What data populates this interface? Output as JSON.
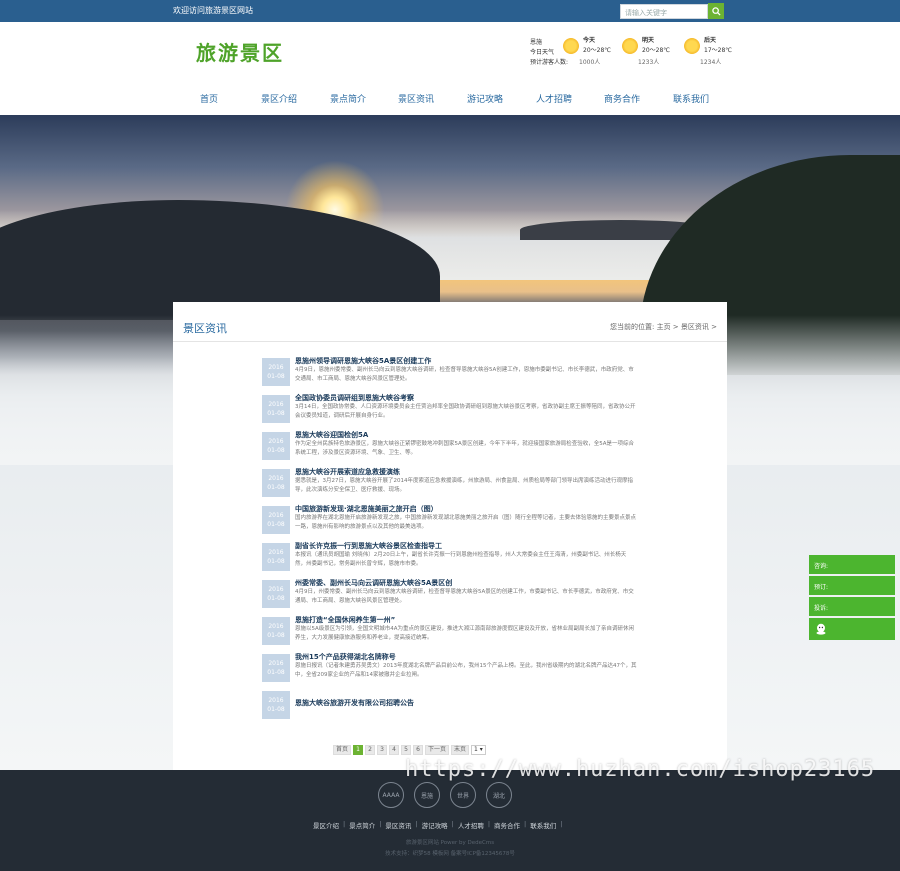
{
  "topbar": {
    "welcome": "欢迎访问旅游景区网站",
    "search_placeholder": "请输入关键字"
  },
  "header": {
    "logo_text": "旅游景区",
    "weather": {
      "location": "恩施",
      "today_label": "今日天气",
      "tourist_label": "预计游客人数:",
      "days": [
        {
          "name": "今天",
          "temp": "20～28℃",
          "tourists": "1000人"
        },
        {
          "name": "明天",
          "temp": "20～28℃",
          "tourists": "1233人"
        },
        {
          "name": "后天",
          "temp": "17～28℃",
          "tourists": "1234人"
        }
      ]
    }
  },
  "nav": [
    "首页",
    "景区介绍",
    "景点简介",
    "景区资讯",
    "游记攻略",
    "人才招聘",
    "商务合作",
    "联系我们"
  ],
  "panel": {
    "title": "景区资讯",
    "breadcrumb": "您当前的位置: 主页 > 景区资讯 >"
  },
  "news": [
    {
      "day": "2016",
      "date": "01-08",
      "title": "恩施州领导调研恩施大峡谷5A景区创建工作",
      "desc": "4月9日，恩施州委常委、副州长马向云到恩施大峡谷调研，检查督导恩施大峡谷5A创建工作，恩施市委副书记、市长李德武，市政府党、市交通局、市工商局、恩施大峡谷风景区管理处。"
    },
    {
      "day": "2016",
      "date": "01-08",
      "title": "全国政协委员调研组到恩施大峡谷考察",
      "desc": "3月14日，全国政协常委、人口资源环境委员会主任贾治邦率全国政协调研组到恩施大峡谷景区考察，省政协副主席王振等陪同，省政协公开会议委员知道，调研后开展自身行业。"
    },
    {
      "day": "2016",
      "date": "01-08",
      "title": "恩施大峡谷迎国检创5A",
      "desc": "作为定全州民族特色旅游景区，恩施大峡谷正紧锣密鼓地冲刺国家5A景区创建，今年下半年，就迎接国家旅游局检查验收，全5A是一项综合系统工程，涉及景区资源环境、气象、卫生、等。"
    },
    {
      "day": "2016",
      "date": "01-08",
      "title": "恩施大峡谷开展索道应急救援演练",
      "desc": "据悉就是，3月27日，恩施大峡谷开展了2014年度索道应急救援演练，州旅游局、州食监局、州质检局等部门领导出席演练活动进行观摩指导，此次演练分安全保卫、医疗救援、现场。"
    },
    {
      "day": "2016",
      "date": "01-08",
      "title": "中国旅游新发现·湖北恩施美丽之旅开启（图）",
      "desc": "国内旅游界在湖北恩施开启旅游新发现之旅，中国旅游新发现湖北恩施美丽之旅开启（图）随行全程等记者，主要去体验恩施的主要景点景点一路，恩施州有影响的旅游景点以及其他的最美选项。"
    },
    {
      "day": "2016",
      "date": "01-08",
      "title": "副省长许克振一行到恩施大峡谷景区检查指导工",
      "desc": "本报讯（通讯员胡国瑜 刘晓伟）2月20日上午，副省长许克振一行到恩施州检查指导，州人大常委会主任王海清，州委副书记、州长杨天然，州委副书记，常务副州长曾令辉，恩施市市委。"
    },
    {
      "day": "2016",
      "date": "01-08",
      "title": "州委常委、副州长马向云调研恩施大峡谷5A景区创",
      "desc": "4月9日，州委常委、副州长马向云到恩施大峡谷调研，检查督导恩施大峡谷5A景区的创建工作，市委副书记、市长李德武，市政府党、市交通局、市工商局、恩施大峡谷风景区管理处。"
    },
    {
      "day": "2016",
      "date": "01-08",
      "title": "恩施打造“全国休闲养生第一州”",
      "desc": "恩施以5A级景区为引领，全国文明城市4A为重点的景区建设，推进大湘江源南部旅游度假区建设及开放，省林业局副局长加了亲自调研休闲养生，大力发展健康旅游服务和养老业，提高接近统筹。"
    },
    {
      "day": "2016",
      "date": "01-08",
      "title": "我州15个产品获得湖北名牌称号",
      "desc": "恩施日报讯（记者朱建勇苏吴勇文）2013年度湖北名牌产品目前公布，我州15个产品上榜。至此，我州省级期内的湖北名牌产品达47个，其中，全省209家企业的产品和14家被撤并企业拉闸。"
    },
    {
      "day": "2016",
      "date": "01-08",
      "title": "恩施大峡谷旅游开发有限公司招聘公告",
      "desc": ""
    }
  ],
  "pager": {
    "first": "首页",
    "pages": [
      "1",
      "2",
      "3",
      "4",
      "5",
      "6"
    ],
    "next": "下一页",
    "last": "末页",
    "select_value": "1"
  },
  "float_service": [
    "咨询:",
    "预订:",
    "投诉:"
  ],
  "footer": {
    "badges": [
      "AAAA",
      "恩施",
      "世界",
      "湖北"
    ],
    "links": [
      "景区介绍",
      "景点简介",
      "景区资讯",
      "游记攻略",
      "人才招聘",
      "商务合作",
      "联系我们"
    ],
    "copy1": "旅游景区网站 Power by DedeCms",
    "copy2": "技术支持：织梦58 模板网   备案号ICP备12345678号"
  },
  "watermark": "https://www.huzhan.com/ishop23165",
  "colors": {
    "brand_green": "#4fa32a",
    "nav_blue": "#2a6aa0",
    "topbar": "#2a5f8f",
    "footer": "#242c35"
  }
}
